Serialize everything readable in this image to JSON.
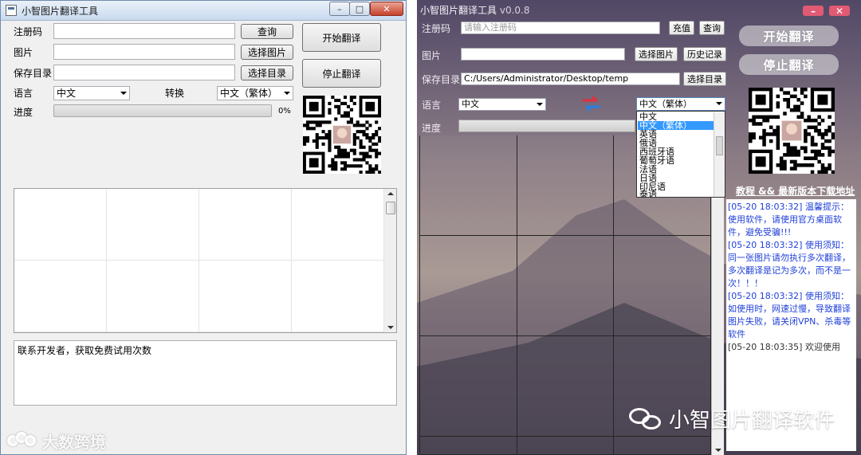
{
  "left_window": {
    "title": "小智图片翻译工具",
    "window_controls": {
      "minimize": "–",
      "maximize": "□",
      "close": "✕"
    },
    "form": {
      "reg_code_label": "注册码",
      "image_label": "图片",
      "save_dir_label": "保存目录",
      "language_label": "语言",
      "convert_label": "转换",
      "progress_label": "进度",
      "source_lang_value": "中文",
      "target_lang_value": "中文（繁体）",
      "progress_percent": "0%",
      "progress_fraction": 0
    },
    "buttons": {
      "query": "查询",
      "select_image": "选择图片",
      "select_dir": "选择目录",
      "start": "开始翻译",
      "stop": "停止翻译"
    },
    "log_text": "联系开发者，获取免费试用次数"
  },
  "watermark_left": "大数跨境",
  "right_window": {
    "title": "小智图片翻译工具",
    "version": "v0.0.8",
    "window_controls": {
      "minimize": "–",
      "close": "✕"
    },
    "form": {
      "reg_code_label": "注册码",
      "reg_code_placeholder": "请输入注册码",
      "image_label": "图片",
      "save_dir_label": "保存目录",
      "save_dir_value": "C:/Users/Administrator/Desktop/temp",
      "language_label": "语言",
      "progress_label": "进度",
      "source_lang_value": "中文",
      "target_lang_value": "中文（繁体）"
    },
    "buttons": {
      "recharge": "充值",
      "query": "查询",
      "select_image": "选择图片",
      "history": "历史记录",
      "select_dir": "选择目录",
      "start": "开始翻译",
      "stop": "停止翻译"
    },
    "target_lang_options": [
      "中文",
      "中文（繁体）",
      "英语",
      "俄语",
      "西班牙语",
      "葡萄牙语",
      "法语",
      "日语",
      "印尼语",
      "泰语"
    ],
    "selected_option_index": 1,
    "links_text": "教程 && 最新版本下载地址",
    "log": [
      {
        "text": "[05-20 18:03:32] 温馨提示：使用软件，请使用官方桌面软件，避免受骗!!!",
        "color": "blue"
      },
      {
        "text": "[05-20 18:03:32] 使用须知：同一张图片请勿执行多次翻译，多次翻译是记为多次，而不是一次！！！",
        "color": "blue"
      },
      {
        "text": "[05-20 18:03:32] 使用须知：如使用时，网速过慢，导致翻译图片失败，请关闭VPN、杀毒等软件",
        "color": "blue"
      },
      {
        "text": "[05-20 18:03:35] 欢迎使用",
        "color": "gray"
      }
    ]
  },
  "watermark_right": "小智图片翻译软件",
  "colors": {
    "skin_close": "#e15a73",
    "log_blue": "#2040d8",
    "dropdown_selected": "#3399ff",
    "swap_icon_red": "#e0303a",
    "swap_icon_blue": "#2a7fe0"
  }
}
